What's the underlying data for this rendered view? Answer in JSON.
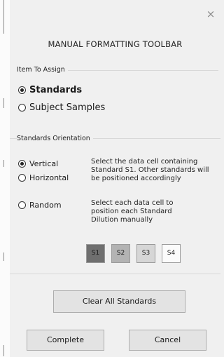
{
  "dialog": {
    "close_glyph": "×",
    "title": "MANUAL FORMATTING TOOLBAR"
  },
  "item_to_assign": {
    "group_label": "Item To Assign",
    "options": [
      {
        "label": "Standards",
        "checked": true
      },
      {
        "label": "Subject Samples",
        "checked": false
      }
    ]
  },
  "standards_orientation": {
    "group_label": "Standards Orientation",
    "options": [
      {
        "label": "Vertical",
        "checked": true
      },
      {
        "label": "Horizontal",
        "checked": false
      },
      {
        "label": "Random",
        "checked": false
      }
    ],
    "vertical_horizontal_description": "Select the data cell containing Standard S1. Other standards will be positioned accordingly",
    "random_description": "Select each data cell to position each Standard Dilution manually"
  },
  "standard_buttons": [
    {
      "label": "S1",
      "bg": "#6f6f6f"
    },
    {
      "label": "S2",
      "bg": "#b3b3b3"
    },
    {
      "label": "S3",
      "bg": "#d6d6d6"
    },
    {
      "label": "S4",
      "bg": "#fbfbfb"
    }
  ],
  "buttons": {
    "clear_all": "Clear All Standards",
    "complete": "Complete",
    "cancel": "Cancel"
  }
}
